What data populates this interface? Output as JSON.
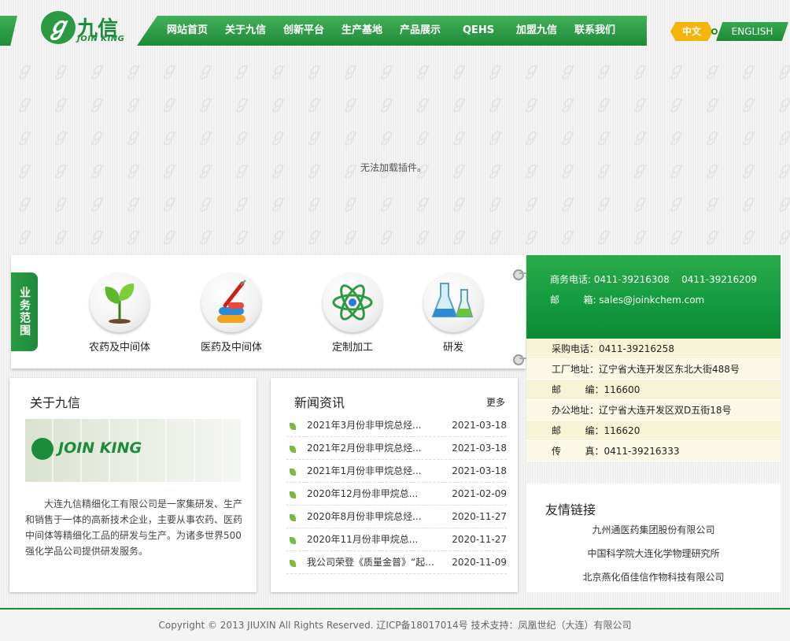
{
  "brand": {
    "cn": "九信",
    "en": "JOIN KING"
  },
  "nav": [
    "网站首页",
    "关于九信",
    "创新平台",
    "生产基地",
    "产品展示",
    "QEHS",
    "加盟九信",
    "联系我们"
  ],
  "lang": {
    "cn": "中文",
    "en": "ENGLISH"
  },
  "plugin_message": "无法加载插件。",
  "scope": {
    "tab": "业务范围",
    "items": [
      "农药及中间体",
      "医药及中间体",
      "定制加工",
      "研发"
    ]
  },
  "contact": {
    "sales_label": "商务电话:",
    "sales_phones": "0411-39216308    0411-39216209",
    "email_label": "邮        箱:",
    "email": "sales@joinkchem.com",
    "rows": [
      "采购电话：0411-39216258",
      "工厂地址：辽宁省大连开发区东北大街488号",
      "邮        编：116600",
      "办公地址：辽宁省大连开发区双D五街18号",
      "邮        编：116620",
      "传        真：0411-39216333"
    ]
  },
  "about": {
    "title": "关于九信",
    "image_text": "JOIN KING",
    "text": "大连九信精细化工有限公司是一家集研发、生产和销售于一体的高新技术企业，主要从事农药、医药中间体等精细化工品的研发与生产。为诸多世界500强化学品公司提供研发服务。"
  },
  "news": {
    "title": "新闻资讯",
    "more": "更多",
    "items": [
      {
        "title": "2021年3月份非甲烷总烃...",
        "date": "2021-03-18"
      },
      {
        "title": "2021年2月份非甲烷总烃...",
        "date": "2021-03-18"
      },
      {
        "title": "2021年1月份非甲烷总烃...",
        "date": "2021-03-18"
      },
      {
        "title": "2020年12月份非甲烷总...",
        "date": "2021-02-09"
      },
      {
        "title": "2020年8月份非甲烷总烃...",
        "date": "2020-11-27"
      },
      {
        "title": "2020年11月份非甲烷总...",
        "date": "2020-11-27"
      },
      {
        "title": "我公司荣登《质量金普》“起...",
        "date": "2020-11-09"
      }
    ]
  },
  "links": {
    "title": "友情链接",
    "items": [
      "九州通医药集团股份有限公司",
      "中国科学院大连化学物理研究所",
      "北京燕化佰佳信作物科技有限公司"
    ]
  },
  "footer": "Copyright © 2013 JIUXIN All Rights Reserved. 辽ICP备18017014号 技术支持：凤凰世纪（大连）有限公司",
  "colors": {
    "brand_green": "#1e8a38",
    "accent_yellow": "#f5b40c"
  }
}
